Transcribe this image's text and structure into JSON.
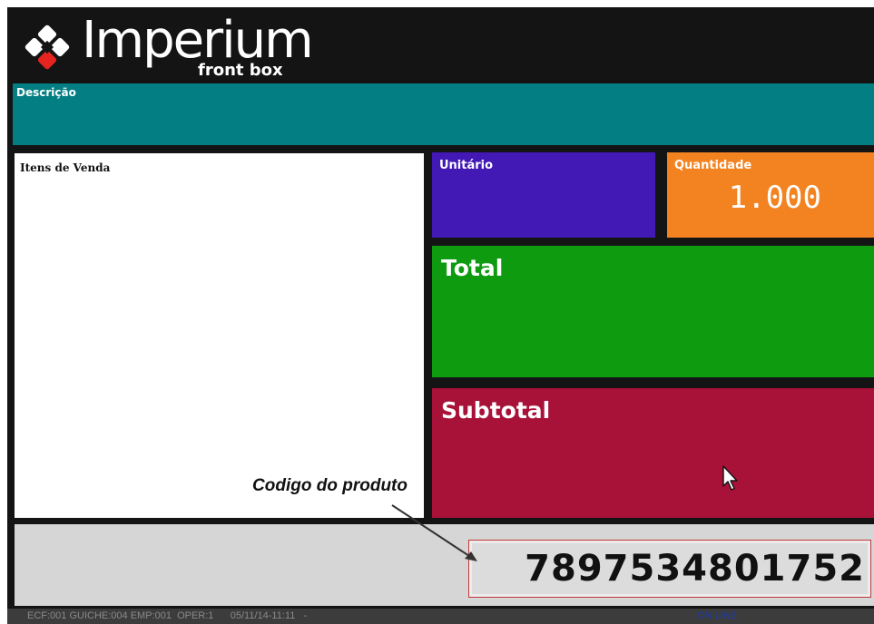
{
  "header": {
    "brand_name": "Imperium",
    "brand_sub": "front box",
    "logo_icon": "four-diamond-logo-icon",
    "colors": {
      "logo_accent": "#e52421",
      "logo_main": "#ffffff",
      "background": "#141414"
    }
  },
  "descricao": {
    "label": "Descrição",
    "value": "",
    "color": "#037e82"
  },
  "itens": {
    "label": "Itens de Venda",
    "items": []
  },
  "unitario": {
    "label": "Unitário",
    "value": "",
    "color": "#4219b5"
  },
  "quantidade": {
    "label": "Quantidade",
    "value": "1.000",
    "color": "#f38321"
  },
  "total": {
    "label": "Total",
    "value": "",
    "color": "#0e9b10"
  },
  "subtotal": {
    "label": "Subtotal",
    "value": "",
    "color": "#a81238"
  },
  "codigo": {
    "label": "Codigo do produto",
    "value": "7897534801752",
    "arrow_icon": "arrow-pointer-icon"
  },
  "status": {
    "text": "ECF:001 GUICHE:004 EMP:001  OPER:1      05/11/14-11:11   -",
    "online": "ON LINE"
  },
  "cursor_icon": "mouse-cursor-icon"
}
